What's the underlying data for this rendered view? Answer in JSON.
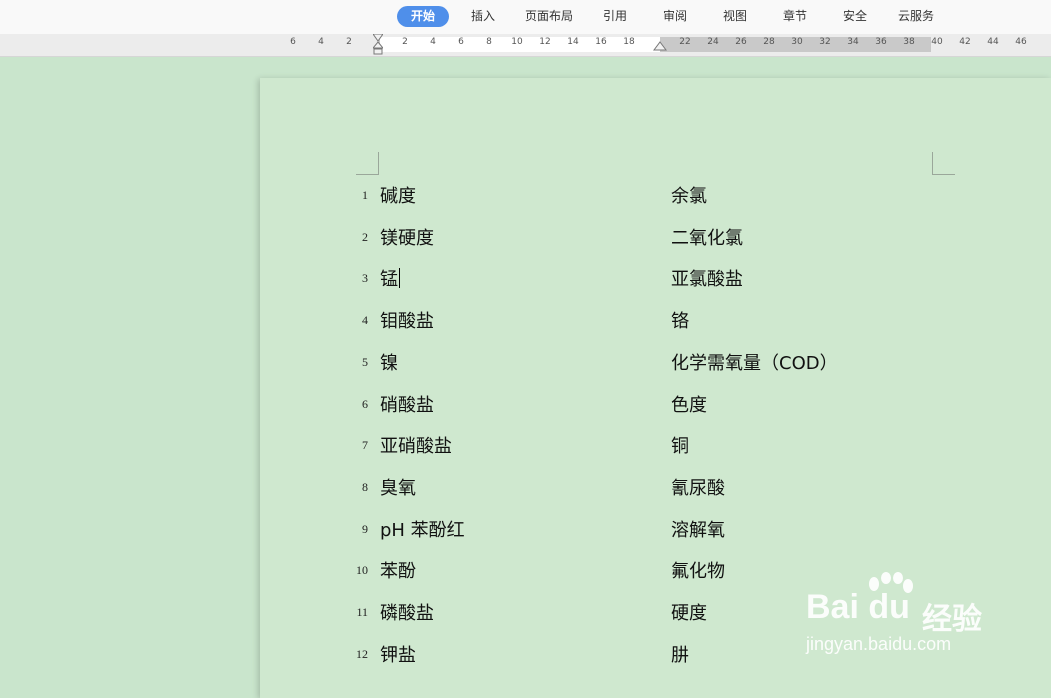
{
  "menu": {
    "tabs": [
      {
        "label": "开始",
        "active": true
      },
      {
        "label": "插入"
      },
      {
        "label": "页面布局"
      },
      {
        "label": "引用"
      },
      {
        "label": "审阅"
      },
      {
        "label": "视图"
      },
      {
        "label": "章节"
      },
      {
        "label": "安全"
      },
      {
        "label": "云服务"
      }
    ],
    "accent_color": "#4f8fea"
  },
  "ruler": {
    "numbers": [
      "6",
      "4",
      "2",
      "2",
      "4",
      "6",
      "8",
      "10",
      "12",
      "14",
      "16",
      "18",
      "22",
      "24",
      "26",
      "28",
      "30",
      "32",
      "34",
      "36",
      "38",
      "40",
      "42",
      "44",
      "46"
    ]
  },
  "document": {
    "background_color": "#cfe8cf",
    "rows": [
      {
        "num": "1",
        "left": "碱度",
        "right": "余氯"
      },
      {
        "num": "2",
        "left": "镁硬度",
        "right": "二氧化氯"
      },
      {
        "num": "3",
        "left": "锰",
        "right": "亚氯酸盐"
      },
      {
        "num": "4",
        "left": "钼酸盐",
        "right": "铬"
      },
      {
        "num": "5",
        "left": "镍",
        "right": "化学需氧量（COD）"
      },
      {
        "num": "6",
        "left": "硝酸盐",
        "right": "色度"
      },
      {
        "num": "7",
        "left": "亚硝酸盐",
        "right": "铜"
      },
      {
        "num": "8",
        "left": "臭氧",
        "right": "氰尿酸"
      },
      {
        "num": "9",
        "left": "pH 苯酚红",
        "right": "溶解氧"
      },
      {
        "num": "10",
        "left": "苯酚",
        "right": "氟化物"
      },
      {
        "num": "11",
        "left": "磷酸盐",
        "right": "硬度"
      },
      {
        "num": "12",
        "left": "钾盐",
        "right": "肼"
      }
    ]
  },
  "watermark": {
    "logo": "Bai du",
    "cn": "经验",
    "url": "jingyan.baidu.com"
  }
}
